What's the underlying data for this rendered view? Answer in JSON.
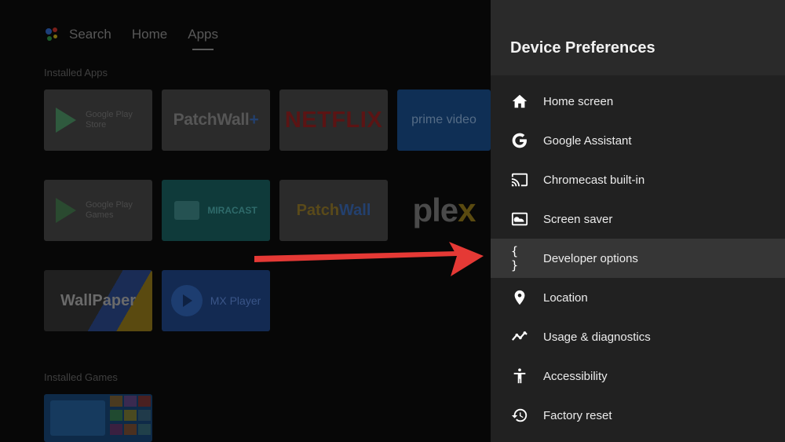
{
  "launcher": {
    "nav": [
      {
        "label": "Search"
      },
      {
        "label": "Home"
      },
      {
        "label": "Apps",
        "active": true
      }
    ],
    "installed_apps_label": "Installed Apps",
    "installed_games_label": "Installed Games",
    "apps": {
      "google_play_store": "Google Play Store",
      "patchwall_plus": "PatchWall",
      "patchwall_plus_sign": "+",
      "netflix": "NETFLIX",
      "prime_video": "prime video",
      "google_play_games": "Google Play Games",
      "miracast": "MIRACAST",
      "patchwall_a": "Patch",
      "patchwall_b": "Wall",
      "plex_a": "ple",
      "plex_b": "x",
      "wallpaper": "WallPaper",
      "mx_player": "MX Player"
    }
  },
  "panel": {
    "title": "Device Preferences",
    "items": [
      {
        "label": "Home screen",
        "icon": "home-icon"
      },
      {
        "label": "Google Assistant",
        "icon": "google-g-icon"
      },
      {
        "label": "Chromecast built-in",
        "icon": "cast-icon"
      },
      {
        "label": "Screen saver",
        "icon": "screen-saver-icon"
      },
      {
        "label": "Developer options",
        "icon": "braces-icon",
        "selected": true
      },
      {
        "label": "Location",
        "icon": "location-pin-icon"
      },
      {
        "label": "Usage & diagnostics",
        "icon": "trend-line-icon"
      },
      {
        "label": "Accessibility",
        "icon": "accessibility-icon"
      },
      {
        "label": "Factory reset",
        "icon": "history-icon"
      }
    ],
    "braces_glyph": "{ }"
  },
  "colors": {
    "panel_bg": "#212121",
    "panel_header_bg": "#2a2a2a",
    "selected_bg": "#363636",
    "arrow": "#e53935"
  }
}
